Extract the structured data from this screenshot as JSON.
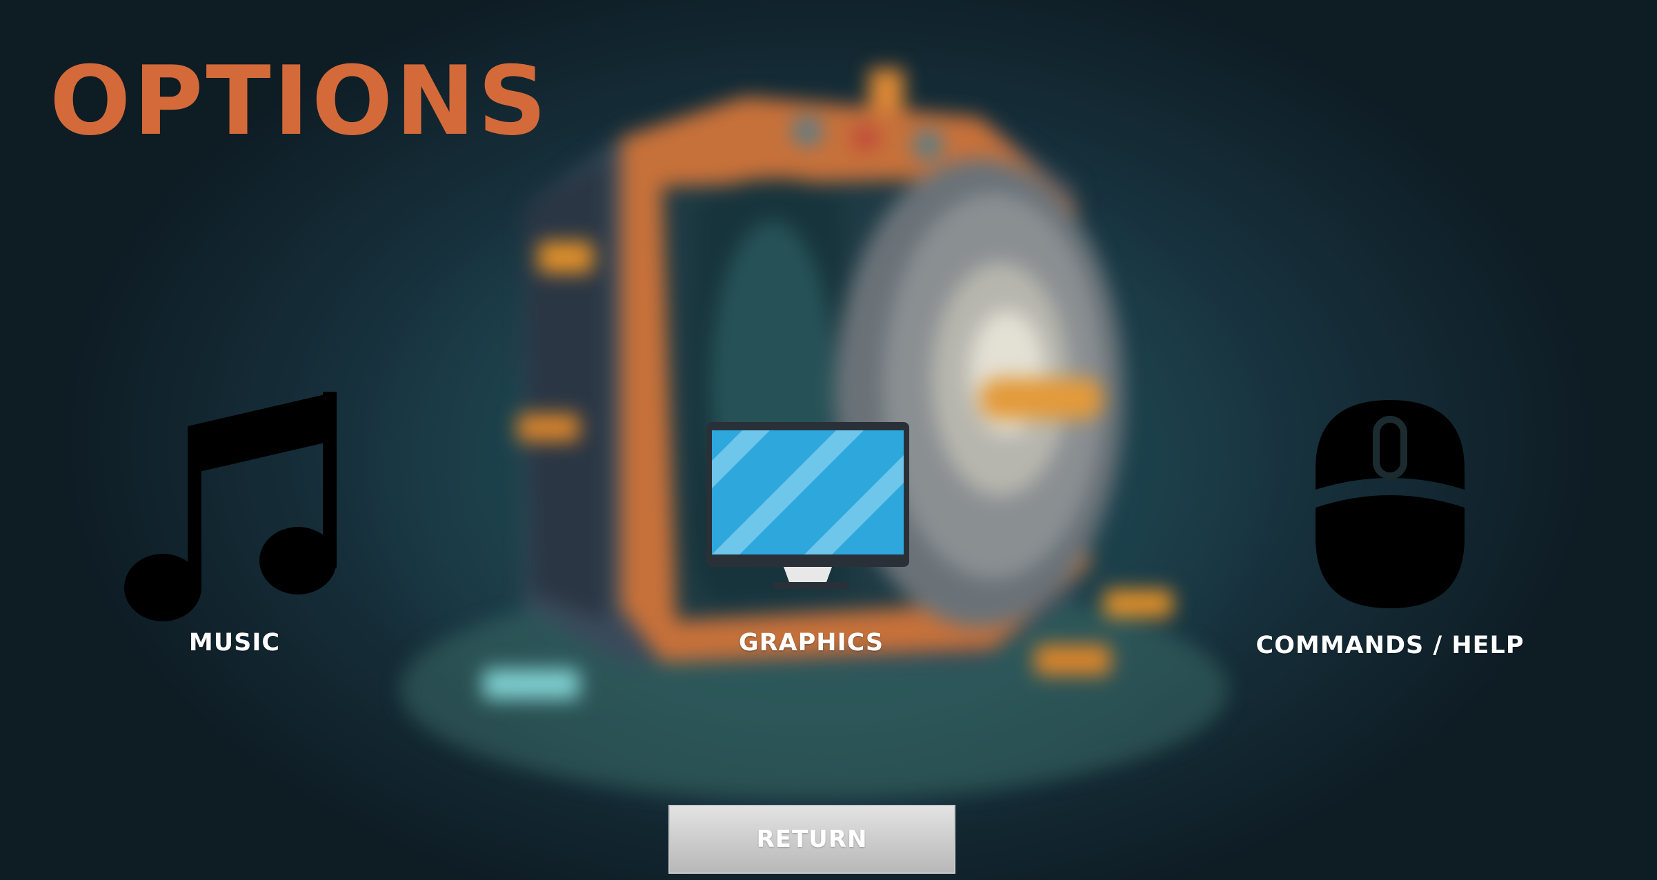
{
  "screen": {
    "title": "OPTIONS",
    "background": "blurred-vault-artwork"
  },
  "options": [
    {
      "label": "MUSIC",
      "icon": "music-note-icon"
    },
    {
      "label": "GRAPHICS",
      "icon": "monitor-icon"
    },
    {
      "label": "COMMANDS / HELP",
      "icon": "mouse-icon"
    }
  ],
  "return_button": {
    "label": "RETURN"
  },
  "colors": {
    "title": "#d46a3a",
    "label": "#ffffff",
    "icon": "#000000",
    "monitor_screen": "#2ea8dc",
    "button": "#cdcdcd"
  }
}
